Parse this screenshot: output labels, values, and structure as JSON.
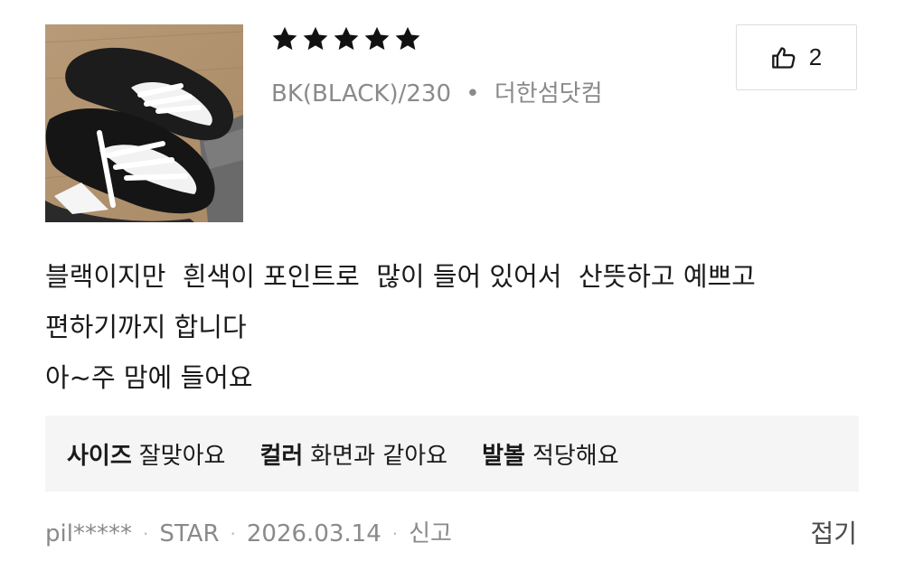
{
  "review": {
    "rating": 5,
    "rating_max": 5,
    "option_text": "BK(BLACK)/230",
    "option_separator": "•",
    "store_name": "더한섬닷컴",
    "helpful_count": "2",
    "body_lines": [
      "블랙이지만  흰색이 포인트로  많이 들어 있어서  산뜻하고 예쁘고",
      "편하기까지 합니다",
      "아~주 맘에 들어요"
    ],
    "evaluations": [
      {
        "key": "사이즈",
        "value": "잘맞아요"
      },
      {
        "key": "컬러",
        "value": "화면과 같아요"
      },
      {
        "key": "발볼",
        "value": "적당해요"
      }
    ],
    "meta": {
      "author": "pil*****",
      "grade": "STAR",
      "date": "2026.03.14",
      "report_label": "신고",
      "separator": "·"
    },
    "fold_label": "접기"
  },
  "icons": {
    "rating_star": "star-icon",
    "helpful": "thumbs-up-icon"
  },
  "colors": {
    "star": "#111111",
    "muted_text": "#8a8a8a",
    "eval_background": "#f5f5f5"
  }
}
